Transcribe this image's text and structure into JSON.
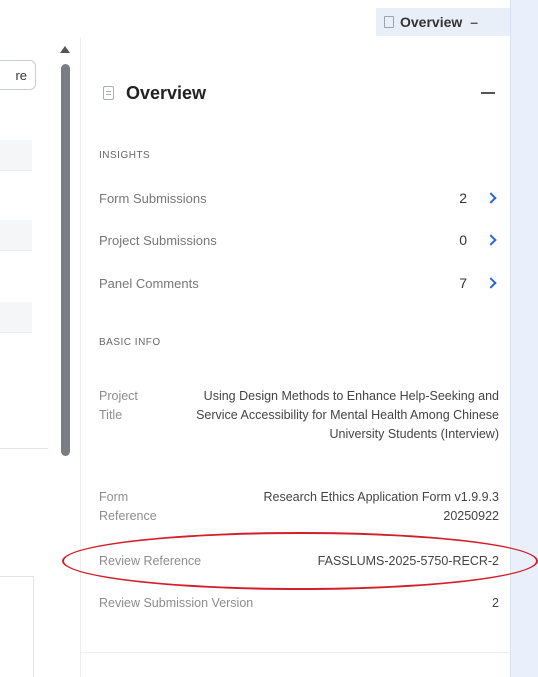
{
  "top_tab": {
    "label": "Overview",
    "collapse_symbol": "–",
    "icon": "document-icon"
  },
  "left_panel": {
    "button_partial_label": "re"
  },
  "overview": {
    "title": "Overview",
    "icon": "document-icon",
    "insights_label": "INSIGHTS",
    "insights": [
      {
        "label": "Form Submissions",
        "count": "2"
      },
      {
        "label": "Project Submissions",
        "count": "0"
      },
      {
        "label": "Panel Comments",
        "count": "7"
      }
    ],
    "basic_info_label": "BASIC INFO",
    "basic_info": {
      "project_title_key": "Project Title",
      "project_title_value": "Using Design Methods to Enhance Help-Seeking and Service Accessibility for Mental Health Among Chinese University Students (Interview)",
      "form_reference_key": "Form Reference",
      "form_reference_value": "Research Ethics Application Form v1.9.9.3 20250922",
      "review_reference_key": "Review Reference",
      "review_reference_value": "FASSLUMS-2025-5750-RECR-2",
      "review_submission_version_key": "Review Submission Version",
      "review_submission_version_value": "2"
    }
  },
  "colors": {
    "accent_blue": "#2b64d8",
    "highlight_red": "#d21f2a",
    "side_strip": "#e9f0fb"
  }
}
